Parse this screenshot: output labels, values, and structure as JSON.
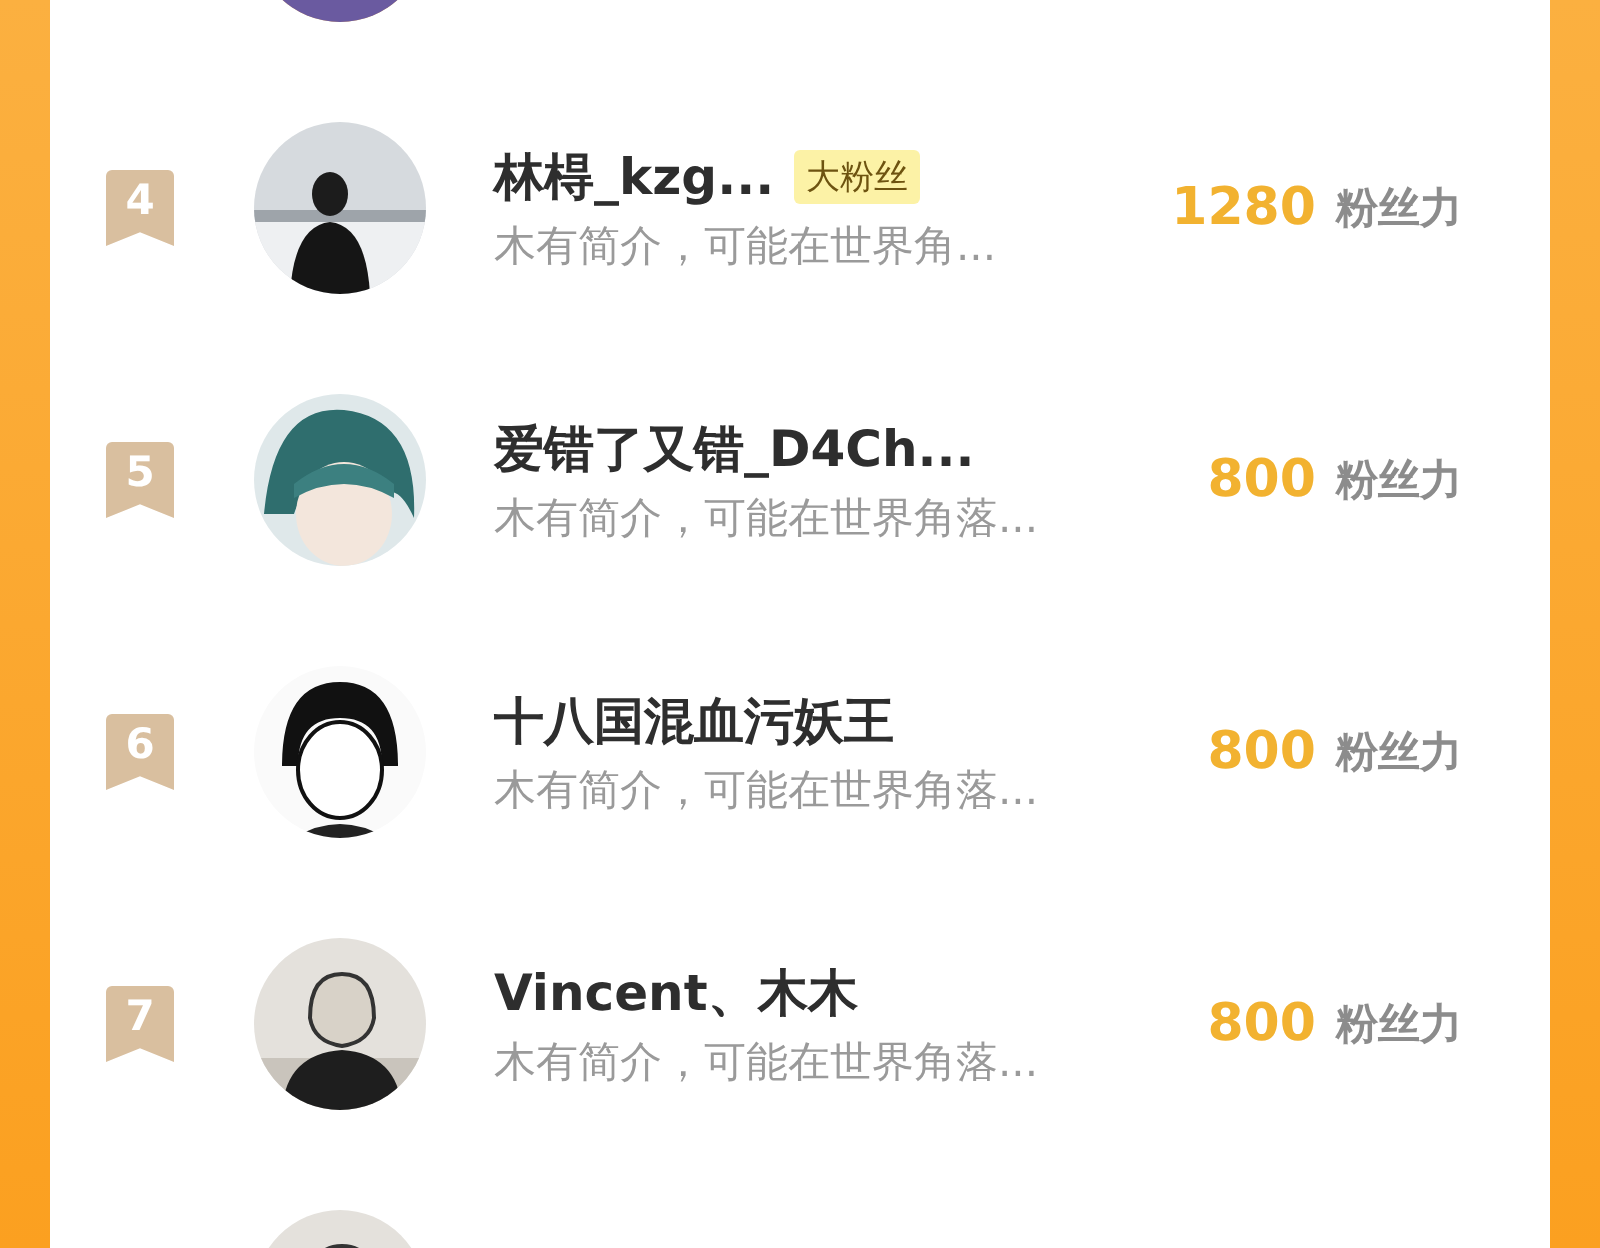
{
  "rows": [
    {
      "kind": "cut"
    },
    {
      "kind": "full",
      "rank": "4",
      "name": "林棏_kzg...",
      "badge": "大粉丝",
      "bio": "木有简介，可能在世界角...",
      "score": "1280",
      "score_unit": "粉丝力"
    },
    {
      "kind": "full",
      "rank": "5",
      "name": "爱错了又错_D4Ch...",
      "bio": "木有简介，可能在世界角落...",
      "score": "800",
      "score_unit": "粉丝力"
    },
    {
      "kind": "full",
      "rank": "6",
      "name": "十八国混血污妖王",
      "bio": "木有简介，可能在世界角落...",
      "score": "800",
      "score_unit": "粉丝力"
    },
    {
      "kind": "full",
      "rank": "7",
      "name": "Vincent、木木",
      "bio": "木有简介，可能在世界角落...",
      "score": "800",
      "score_unit": "粉丝力"
    },
    {
      "kind": "cut"
    }
  ]
}
